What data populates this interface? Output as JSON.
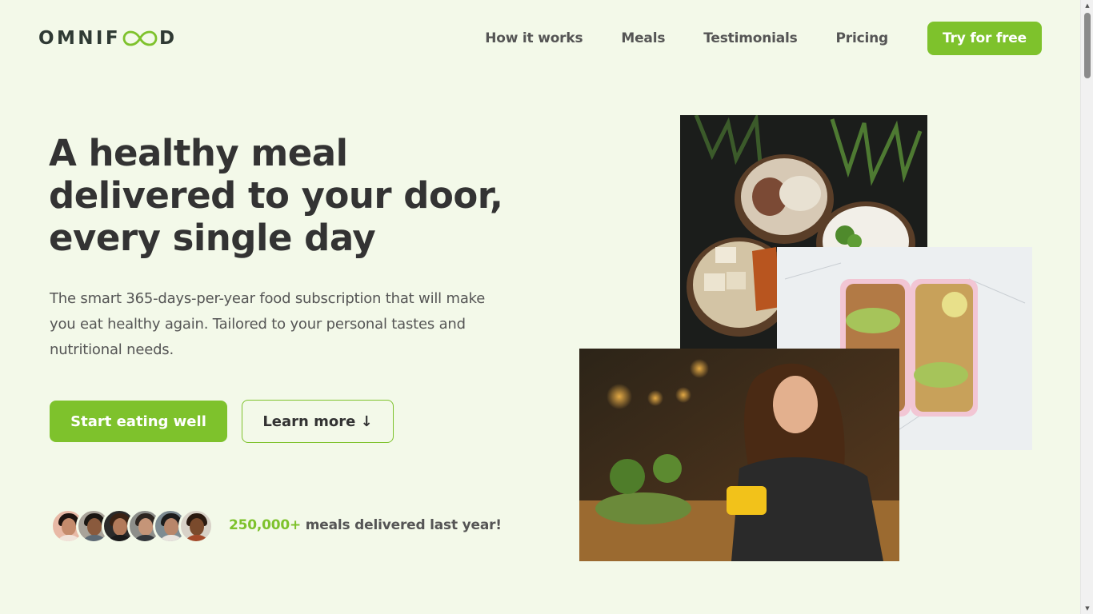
{
  "header": {
    "logo": {
      "text_before": "OMNIF",
      "text_after": "D"
    },
    "nav": [
      {
        "label": "How it works"
      },
      {
        "label": "Meals"
      },
      {
        "label": "Testimonials"
      },
      {
        "label": "Pricing"
      }
    ],
    "cta_label": "Try for free"
  },
  "hero": {
    "title": "A healthy meal delivered to your door, every single day",
    "description": "The smart 365-days-per-year food subscription that will make you eat healthy again. Tailored to your personal tastes and nutritional needs.",
    "primary_button": "Start eating well",
    "secondary_button": "Learn more ↓",
    "delivered": {
      "count": "250,000+",
      "text": "meals delivered last year!"
    }
  },
  "icons": {
    "logo_loop": "infinity-icon",
    "scroll_up": "chevron-up-icon",
    "scroll_down": "chevron-down-icon"
  },
  "colors": {
    "accent": "#7ec22c",
    "background": "#f3f9e9",
    "text": "#333333"
  }
}
